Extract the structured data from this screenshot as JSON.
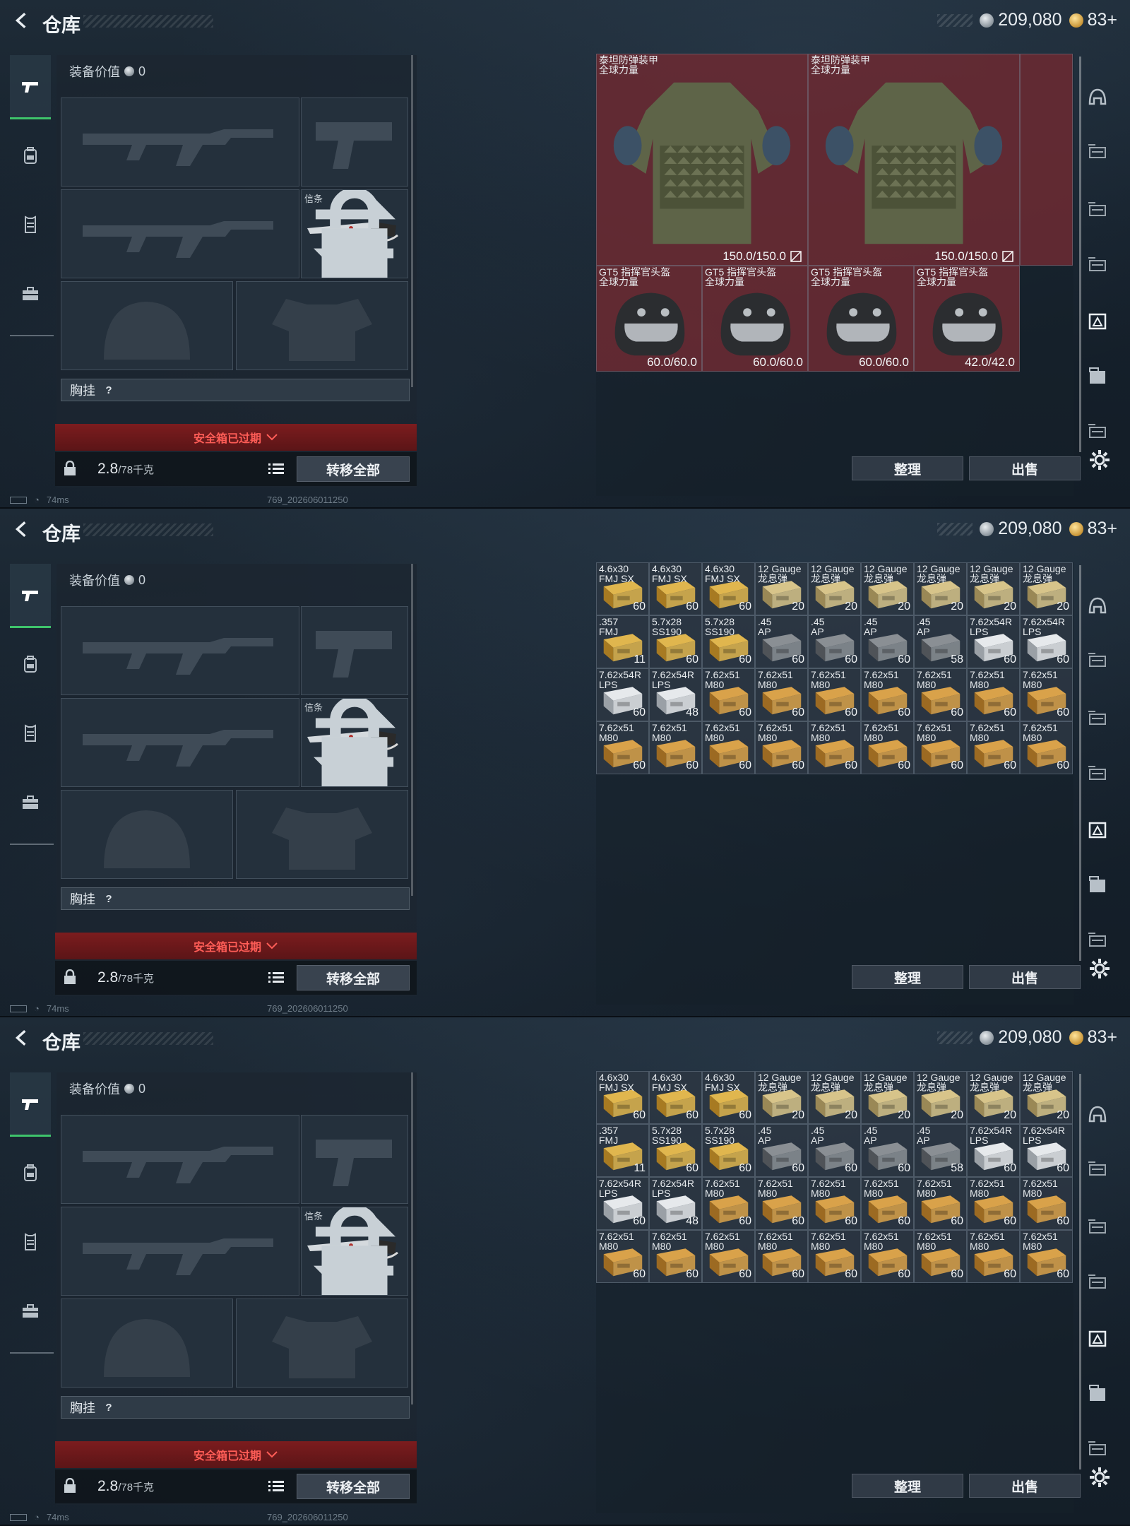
{
  "header": {
    "title": "仓库",
    "silver": "209,080",
    "gold": "83+"
  },
  "equip": {
    "value_label": "装备价值",
    "value": "0",
    "melee_label": "信条",
    "chest_label": "胸挂",
    "help": "?",
    "expired_label": "安全箱已过期",
    "weight": "2.8",
    "weight_unit": "/78千克",
    "transfer_label": "转移全部"
  },
  "status": {
    "ping": "74ms",
    "build": "769_202606011250"
  },
  "actions": {
    "sort_label": "整理",
    "sell_label": "出售"
  },
  "icons": {
    "left_nav": [
      "pistol-icon",
      "backpack-icon",
      "vest-icon",
      "briefcase-icon"
    ],
    "right_nav": [
      "helmet-icon",
      "armor-level-3-icon",
      "armor-level-4-icon",
      "rig-icon",
      "case-icon",
      "box-icon",
      "armor-level-4-small-icon"
    ],
    "settings": "gear-icon"
  },
  "colors": {
    "expired": "#ff5d57",
    "active_tab": "#3ec46b",
    "armor_cell": "#7a2c34"
  },
  "panel1": {
    "armor": [
      {
        "name": "泰坦防弹装甲",
        "sub": "全球力量",
        "durability": "150.0/150.0"
      },
      {
        "name": "泰坦防弹装甲",
        "sub": "全球力量",
        "durability": "150.0/150.0"
      }
    ],
    "helmets": [
      {
        "name": "GT5 指挥官头盔",
        "sub": "全球力量",
        "durability": "60.0/60.0"
      },
      {
        "name": "GT5 指挥官头盔",
        "sub": "全球力量",
        "durability": "60.0/60.0"
      },
      {
        "name": "GT5 指挥官头盔",
        "sub": "全球力量",
        "durability": "60.0/60.0"
      },
      {
        "name": "GT5 指挥官头盔",
        "sub": "全球力量",
        "durability": "42.0/42.0"
      }
    ]
  },
  "ammo": [
    {
      "name": "4.6x30",
      "sub": "FMJ SX",
      "count": "60",
      "box": "gold"
    },
    {
      "name": "4.6x30",
      "sub": "FMJ SX",
      "count": "60",
      "box": "gold"
    },
    {
      "name": "4.6x30",
      "sub": "FMJ SX",
      "count": "60",
      "box": "gold"
    },
    {
      "name": "12 Gauge",
      "sub": "龙息弹",
      "count": "20",
      "box": "tan"
    },
    {
      "name": "12 Gauge",
      "sub": "龙息弹",
      "count": "20",
      "box": "tan"
    },
    {
      "name": "12 Gauge",
      "sub": "龙息弹",
      "count": "20",
      "box": "tan"
    },
    {
      "name": "12 Gauge",
      "sub": "龙息弹",
      "count": "20",
      "box": "tan"
    },
    {
      "name": "12 Gauge",
      "sub": "龙息弹",
      "count": "20",
      "box": "tan"
    },
    {
      "name": "12 Gauge",
      "sub": "龙息弹",
      "count": "20",
      "box": "tan"
    },
    {
      "name": ".357",
      "sub": "FMJ",
      "count": "11",
      "box": "gold"
    },
    {
      "name": "5.7x28",
      "sub": "SS190",
      "count": "60",
      "box": "gold"
    },
    {
      "name": "5.7x28",
      "sub": "SS190",
      "count": "60",
      "box": "gold"
    },
    {
      "name": ".45",
      "sub": "AP",
      "count": "60",
      "box": "grey"
    },
    {
      "name": ".45",
      "sub": "AP",
      "count": "60",
      "box": "grey"
    },
    {
      "name": ".45",
      "sub": "AP",
      "count": "60",
      "box": "grey"
    },
    {
      "name": ".45",
      "sub": "AP",
      "count": "58",
      "box": "grey"
    },
    {
      "name": "7.62x54R",
      "sub": "LPS",
      "count": "60",
      "box": "white"
    },
    {
      "name": "7.62x54R",
      "sub": "LPS",
      "count": "60",
      "box": "white"
    },
    {
      "name": "7.62x54R",
      "sub": "LPS",
      "count": "60",
      "box": "white"
    },
    {
      "name": "7.62x54R",
      "sub": "LPS",
      "count": "48",
      "box": "white"
    },
    {
      "name": "7.62x51",
      "sub": "M80",
      "count": "60",
      "box": "wood"
    },
    {
      "name": "7.62x51",
      "sub": "M80",
      "count": "60",
      "box": "wood"
    },
    {
      "name": "7.62x51",
      "sub": "M80",
      "count": "60",
      "box": "wood"
    },
    {
      "name": "7.62x51",
      "sub": "M80",
      "count": "60",
      "box": "wood"
    },
    {
      "name": "7.62x51",
      "sub": "M80",
      "count": "60",
      "box": "wood"
    },
    {
      "name": "7.62x51",
      "sub": "M80",
      "count": "60",
      "box": "wood"
    },
    {
      "name": "7.62x51",
      "sub": "M80",
      "count": "60",
      "box": "wood"
    },
    {
      "name": "7.62x51",
      "sub": "M80",
      "count": "60",
      "box": "wood"
    },
    {
      "name": "7.62x51",
      "sub": "M80",
      "count": "60",
      "box": "wood"
    },
    {
      "name": "7.62x51",
      "sub": "M80",
      "count": "60",
      "box": "wood"
    },
    {
      "name": "7.62x51",
      "sub": "M80",
      "count": "60",
      "box": "wood"
    },
    {
      "name": "7.62x51",
      "sub": "M80",
      "count": "60",
      "box": "wood"
    },
    {
      "name": "7.62x51",
      "sub": "M80",
      "count": "60",
      "box": "wood"
    },
    {
      "name": "7.62x51",
      "sub": "M80",
      "count": "60",
      "box": "wood"
    },
    {
      "name": "7.62x51",
      "sub": "M80",
      "count": "60",
      "box": "wood"
    },
    {
      "name": "7.62x51",
      "sub": "M80",
      "count": "60",
      "box": "wood"
    }
  ]
}
